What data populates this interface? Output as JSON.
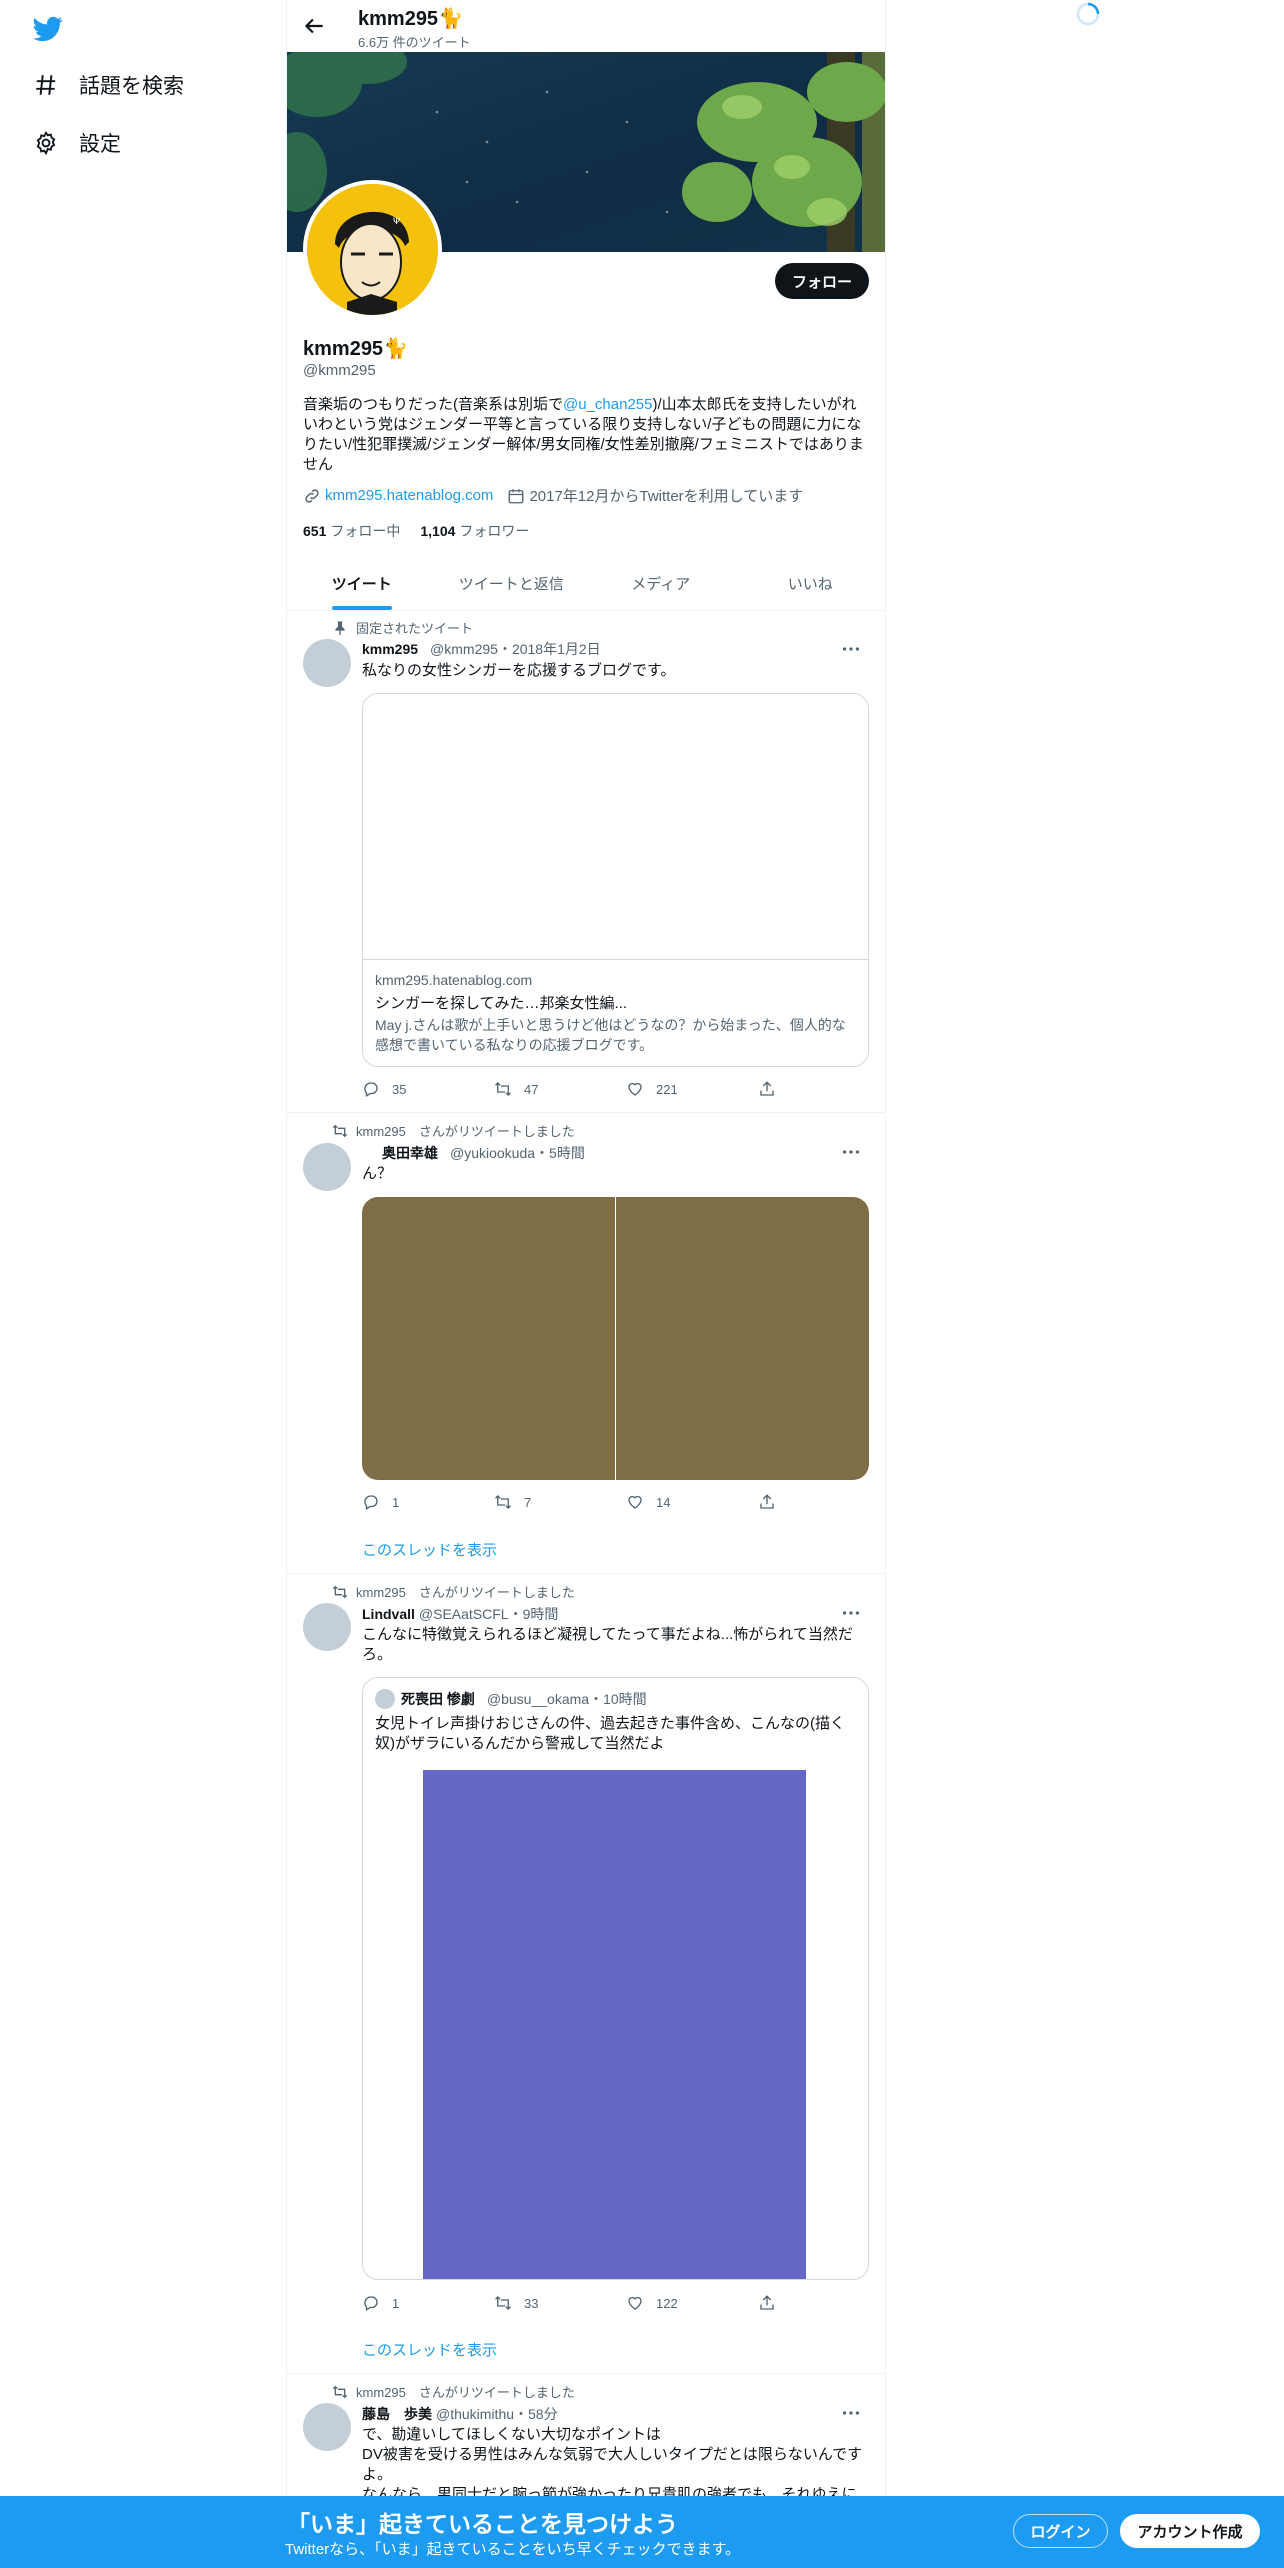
{
  "nav": {
    "logo": "twitter-bird-icon",
    "items": [
      {
        "icon": "hashtag-icon",
        "label": "話題を検索"
      },
      {
        "icon": "gear-icon",
        "label": "設定"
      }
    ]
  },
  "header": {
    "name": "kmm295🐈",
    "tweet_count": "6.6万 件のツイート"
  },
  "profile": {
    "name": "kmm295🐈",
    "handle": "@kmm295",
    "bio_part1": "音楽垢のつもりだった(音楽系は別垢で",
    "bio_mention": "@u_chan255",
    "bio_part2": ")/山本太郎氏を支持したいがれいわという党はジェンダー平等と言っている限り支持しない/子どもの問題に力になりたい/性犯罪撲滅/ジェンダー解体/男女同権/女性差別撤廃/フェミニストではありません",
    "website": "kmm295.hatenablog.com",
    "joined": "2017年12月からTwitterを利用しています",
    "following_count": "651",
    "following_label": "フォロー中",
    "followers_count": "1,104",
    "followers_label": "フォロワー",
    "follow_button": "フォロー"
  },
  "tabs": [
    "ツイート",
    "ツイートと返信",
    "メディア",
    "いいね"
  ],
  "tweets": [
    {
      "pinned_label": "固定されたツイート",
      "name": "kmm295",
      "handle_time": "@kmm295・2018年1月2日",
      "text": "私なりの女性シンガーを応援するブログです。",
      "card": {
        "domain": "kmm295.hatenablog.com",
        "title": "シンガーを探してみた…邦楽女性編...",
        "description": "May j.さんは歌が上手いと思うけど他はどうなの？から始まった、個人的な感想で書いている私なりの応援ブログです。"
      },
      "replies": "35",
      "retweets": "47",
      "likes": "221"
    },
    {
      "retweeted_by": "kmm295　さんがリツイートしました",
      "name": "奥田幸雄",
      "handle_time": "@yukiookuda・5時間",
      "text": "ん？",
      "replies": "1",
      "retweets": "7",
      "likes": "14",
      "thread_link": "このスレッドを表示"
    },
    {
      "retweeted_by": "kmm295　さんがリツイートしました",
      "name": "Lindvall",
      "handle_time": "@SEAatSCFL・9時間",
      "text": "こんなに特徴覚えられるほど凝視してたって事だよね...怖がられて当然だろ。",
      "quote": {
        "name": "死喪田 惨劇",
        "handle_time": "@busu__okama・10時間",
        "text": "女児トイレ声掛けおじさんの件、過去起きた事件含め、こんなの(描く奴)がザラにいるんだから警戒して当然だよ"
      },
      "replies": "1",
      "retweets": "33",
      "likes": "122",
      "thread_link": "このスレッドを表示"
    },
    {
      "retweeted_by": "kmm295　さんがリツイートしました",
      "name": "藤島　歩美",
      "handle_time": "@thukimithu・58分",
      "text_lines": [
        "で、勘違いしてほしくない大切なポイントは",
        "DV被害を受ける男性はみんな気弱で大人しいタイプだとは限らないんですよ。",
        "なんなら、男同士だと腕っ節が強かったり兄貴肌の強者でも、それゆえに"
      ]
    }
  ],
  "bottom_bar": {
    "title": "「いま」起きていることを見つけよう",
    "subtitle": "Twitterなら、「いま」起きていることをいち早くチェックできます。",
    "login": "ログイン",
    "signup": "アカウント作成"
  },
  "colors": {
    "accent": "#1d9bf0",
    "text": "#0f1419",
    "secondary": "#536471",
    "media_brown": "#7f6d45",
    "media_purple": "#6666c6"
  }
}
